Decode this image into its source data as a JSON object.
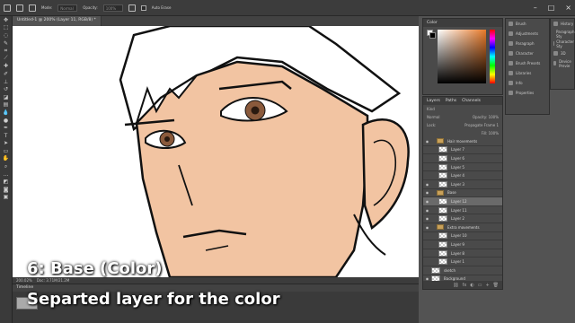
{
  "topbar": {
    "mode_label": "Mode:",
    "mode_value": "Normal",
    "opacity_label": "Opacity:",
    "opacity_value": "100%",
    "auto_erase_label": "Auto Erase"
  },
  "document": {
    "tab_title": "Untitled-1 @ 200% (Layer 11, RGB/8) *"
  },
  "status": {
    "zoom": "200.02%",
    "doc_size": "Doc: 3.71M/21.2M"
  },
  "timeline": {
    "title": "Timeline"
  },
  "caption": {
    "line1": "6: Base (Color)",
    "line2": "Separted layer for the color"
  },
  "color_panel": {
    "title": "Color"
  },
  "mini_panel": {
    "items": [
      "Brush",
      "Adjustments",
      "Paragraph",
      "Character",
      "Brush Presets",
      "Libraries",
      "Info",
      "Properties"
    ]
  },
  "far_panel": {
    "items": [
      "History",
      "Paragraph Sty",
      "Character Sty",
      "3D",
      "Device Previe"
    ]
  },
  "layers_panel": {
    "tabs": [
      "Layers",
      "Paths",
      "Channels"
    ],
    "kind_label": "Kind",
    "blend_mode": "Normal",
    "opacity_label": "Opacity:",
    "opacity_value": "100%",
    "lock_label": "Lock:",
    "propagate_label": "Propagate Frame 1",
    "fill_label": "Fill:",
    "fill_value": "100%",
    "layers": [
      {
        "name": "Hair movements",
        "type": "group",
        "visible": true
      },
      {
        "name": "Layer 7",
        "type": "layer",
        "visible": false
      },
      {
        "name": "Layer 6",
        "type": "layer",
        "visible": false
      },
      {
        "name": "Layer 5",
        "type": "layer",
        "visible": false
      },
      {
        "name": "Layer 4",
        "type": "layer",
        "visible": false
      },
      {
        "name": "Layer 3",
        "type": "layer",
        "visible": true
      },
      {
        "name": "Base",
        "type": "group",
        "visible": true
      },
      {
        "name": "Layer 12",
        "type": "layer",
        "visible": true,
        "selected": true
      },
      {
        "name": "Layer 11",
        "type": "layer",
        "visible": true
      },
      {
        "name": "Layer 2",
        "type": "layer",
        "visible": true
      },
      {
        "name": "Extra movements",
        "type": "group",
        "visible": true
      },
      {
        "name": "Layer 10",
        "type": "layer",
        "visible": false
      },
      {
        "name": "Layer 9",
        "type": "layer",
        "visible": false
      },
      {
        "name": "Layer 8",
        "type": "layer",
        "visible": false
      },
      {
        "name": "Layer 1",
        "type": "layer",
        "visible": false
      },
      {
        "name": "sketch",
        "type": "layer",
        "visible": false
      },
      {
        "name": "Background",
        "type": "layer",
        "visible": true
      }
    ]
  },
  "colors": {
    "skin": "#f2c4a2",
    "eye": "#8a5a3c",
    "ui_dark": "#3c3c3c",
    "ui_mid": "#535353"
  }
}
